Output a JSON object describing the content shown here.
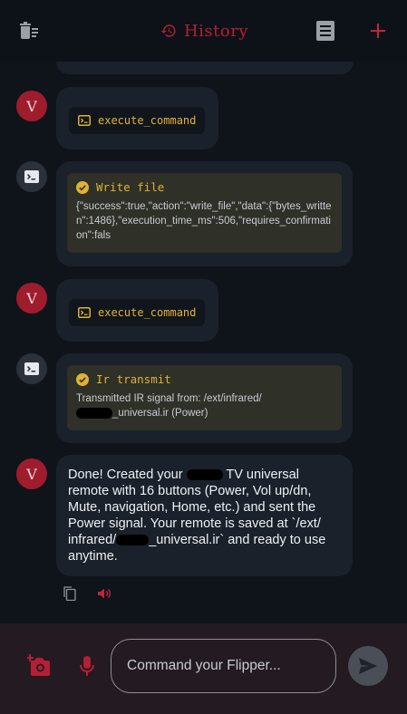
{
  "header": {
    "title": "History",
    "left_icon": "clear-history-icon",
    "title_icon": "history-icon",
    "right_icons": [
      "transcript-icon",
      "add-icon"
    ]
  },
  "messages": [
    {
      "role": "user",
      "avatar": "V",
      "command": "execute_command"
    },
    {
      "role": "tool",
      "result_title": "Write file",
      "result_body": "{\"success\":true,\"action\":\"write_file\",\"data\":{\"bytes_written\":1486},\"execution_time_ms\":506,\"requires_confirmation\":fals"
    },
    {
      "role": "user",
      "avatar": "V",
      "command": "execute_command"
    },
    {
      "role": "tool",
      "result_title": "Ir transmit",
      "result_line1": "Transmitted IR signal from: /ext/infrared/",
      "result_line2": "_universal.ir (Power)"
    },
    {
      "role": "assistant",
      "avatar": "V",
      "text_l1a": "Done! Created your",
      "text_l1b": "TV universal",
      "text_l2": "remote with 16 buttons (Power, Vol up/dn,",
      "text_l3": "Mute, navigation, Home, etc.) and sent the",
      "text_l4": "Power signal. Your remote is saved at `/ext/",
      "text_l5a": "infrared/",
      "text_l5b": "_universal.ir` and ready to use",
      "text_l6": "anytime."
    }
  ],
  "composer": {
    "placeholder": "Command your Flipper..."
  },
  "colors": {
    "accent": "#b51f35",
    "command": "#e0b232",
    "background": "#0f141b",
    "bubble": "#1a212b"
  }
}
